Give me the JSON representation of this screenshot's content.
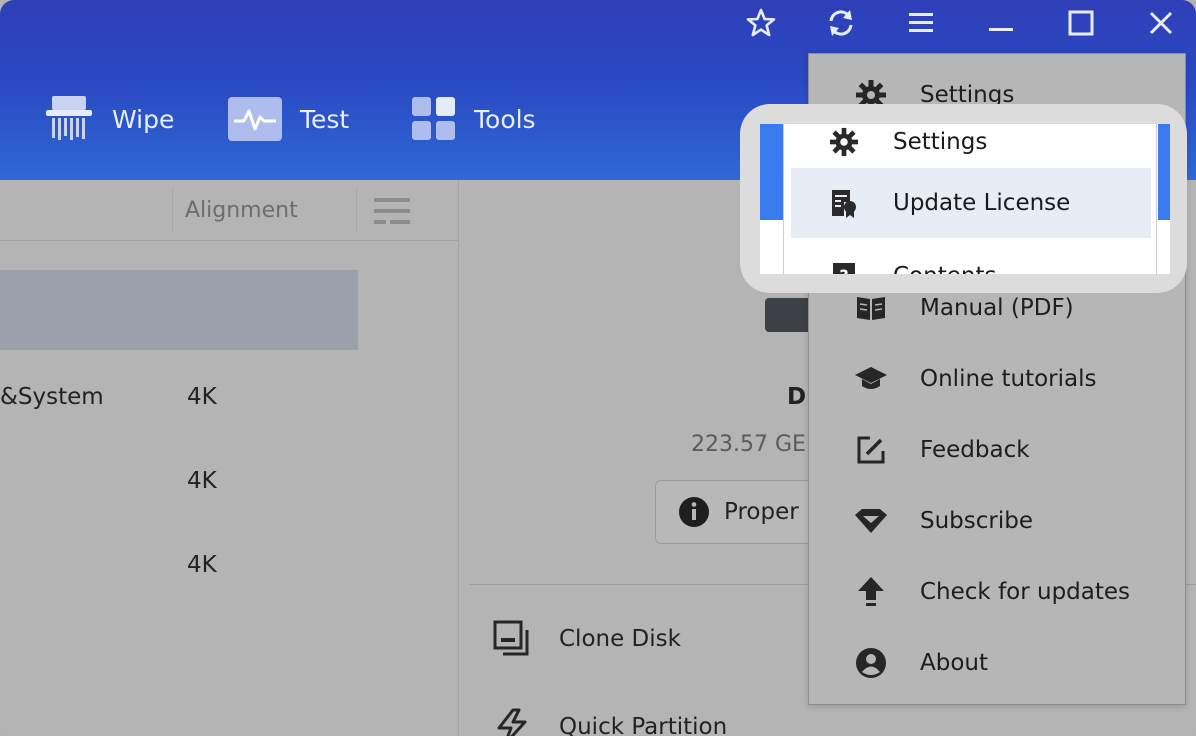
{
  "toolbar": {
    "items": [
      {
        "label": "Wipe",
        "icon": "shredder-icon"
      },
      {
        "label": "Test",
        "icon": "pulse-icon"
      },
      {
        "label": "Tools",
        "icon": "grid-icon"
      }
    ]
  },
  "window_controls": {
    "favorite": "star-icon",
    "refresh": "refresh-icon",
    "menu": "hamburger-icon",
    "minimize": "minimize-icon",
    "maximize": "maximize-icon",
    "close": "close-icon"
  },
  "table": {
    "alignment_header": "Alignment",
    "rows": [
      {
        "name": "&System",
        "alignment": "4K"
      },
      {
        "name": "",
        "alignment": "4K"
      },
      {
        "name": "",
        "alignment": "4K"
      }
    ]
  },
  "detail": {
    "disk_name": "D",
    "disk_size": "223.57 GE",
    "properties_label": "Proper",
    "actions": [
      {
        "label": "Clone Disk",
        "icon": "clone-disk-icon"
      },
      {
        "label": "Quick Partition",
        "icon": "quick-partition-icon"
      }
    ]
  },
  "menu": {
    "items": [
      {
        "label": "Settings",
        "icon": "gear-icon"
      },
      {
        "label": "Manual (PDF)",
        "icon": "book-icon"
      },
      {
        "label": "Online tutorials",
        "icon": "graduation-cap-icon"
      },
      {
        "label": "Feedback",
        "icon": "edit-icon"
      },
      {
        "label": "Subscribe",
        "icon": "diamond-icon"
      },
      {
        "label": "Check for updates",
        "icon": "upload-arrow-icon"
      },
      {
        "label": "About",
        "icon": "user-circle-icon"
      }
    ]
  },
  "callout": {
    "items": [
      {
        "label": "Settings",
        "icon": "gear-icon"
      },
      {
        "label": "Update License",
        "icon": "license-icon"
      },
      {
        "label": "Contents",
        "icon": "help-book-icon"
      }
    ]
  },
  "colors": {
    "titlebar": "#2f3fb8",
    "highlight": "#e7ecf5",
    "accent_blue": "#3a7cf0"
  }
}
